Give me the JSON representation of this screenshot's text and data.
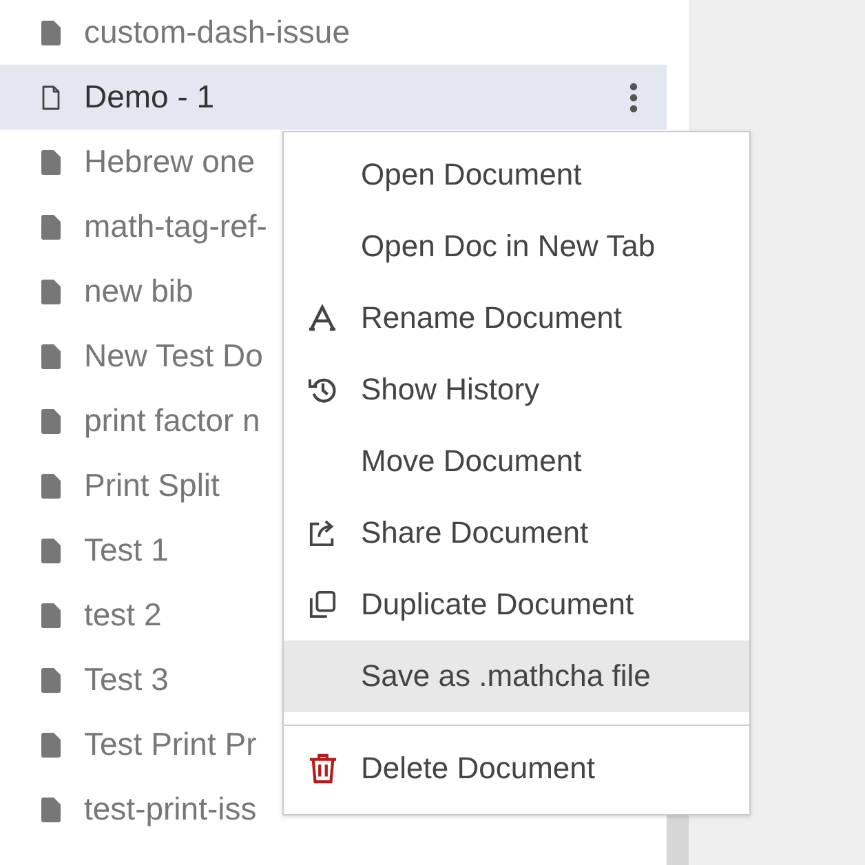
{
  "documents": [
    {
      "name": "custom-dash-issue",
      "selected": false
    },
    {
      "name": "Demo - 1",
      "selected": true
    },
    {
      "name": "Hebrew one",
      "selected": false
    },
    {
      "name": "math-tag-ref-",
      "selected": false
    },
    {
      "name": "new bib",
      "selected": false
    },
    {
      "name": "New Test Do",
      "selected": false
    },
    {
      "name": "print factor n",
      "selected": false
    },
    {
      "name": "Print Split",
      "selected": false
    },
    {
      "name": "Test 1",
      "selected": false
    },
    {
      "name": "test 2",
      "selected": false
    },
    {
      "name": "Test 3",
      "selected": false
    },
    {
      "name": "Test Print Pr",
      "selected": false
    },
    {
      "name": "test-print-iss",
      "selected": false
    }
  ],
  "context_menu": {
    "items": [
      {
        "kind": "plain",
        "label": "Open Document",
        "selected": false
      },
      {
        "kind": "plain",
        "label": "Open Doc in New Tab",
        "selected": false
      },
      {
        "kind": "rename",
        "label": "Rename Document",
        "selected": false
      },
      {
        "kind": "history",
        "label": "Show History",
        "selected": false
      },
      {
        "kind": "plain",
        "label": "Move Document",
        "selected": false
      },
      {
        "kind": "share",
        "label": "Share Document",
        "selected": false
      },
      {
        "kind": "duplicate",
        "label": "Duplicate Document",
        "selected": false
      },
      {
        "kind": "plain",
        "label": "Save as .mathcha file",
        "selected": true
      },
      {
        "kind": "divider"
      },
      {
        "kind": "delete",
        "label": "Delete Document",
        "selected": false
      }
    ]
  }
}
